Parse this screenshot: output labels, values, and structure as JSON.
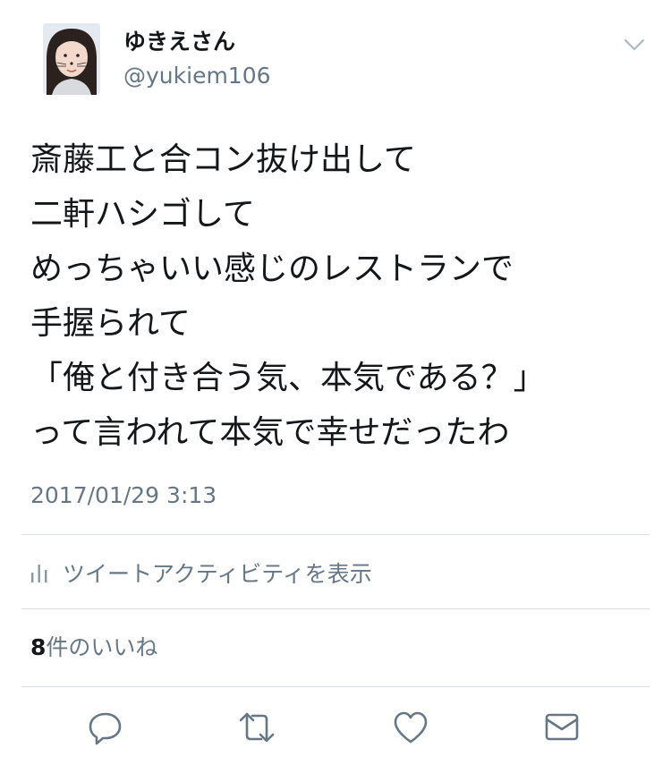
{
  "user": {
    "display_name": "ゆきえさん",
    "handle": "@yukiem106"
  },
  "tweet": {
    "text": "斎藤工と合コン抜け出して\n二軒ハシゴして\nめっちゃいい感じのレストランで\n手握られて\n「俺と付き合う気、本気である？」\nって言われて本気で幸せだったわ",
    "timestamp": "2017/01/29 3:13"
  },
  "activity": {
    "label": "ツイートアクティビティを表示"
  },
  "likes": {
    "count": "8",
    "suffix": "件のいいね"
  },
  "icons": {
    "caret": "chevron-down-icon",
    "activity": "bar-chart-icon",
    "reply": "reply-icon",
    "retweet": "retweet-icon",
    "like": "heart-icon",
    "message": "envelope-icon"
  },
  "colors": {
    "primary_text": "#14171a",
    "secondary_text": "#657786",
    "divider": "#d8dee3"
  }
}
